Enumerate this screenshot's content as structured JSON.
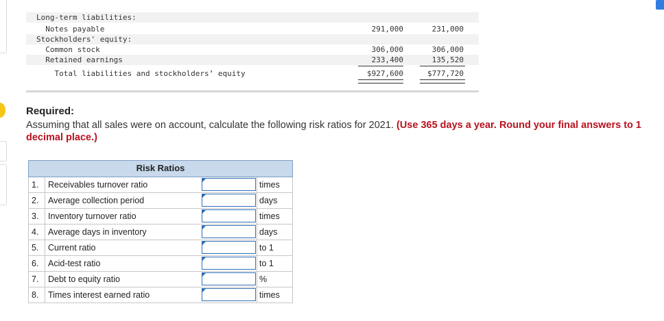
{
  "balance_sheet": {
    "rows": [
      {
        "label": "Long-term liabilities:",
        "v1": "",
        "v2": "",
        "shade": true
      },
      {
        "label": "  Notes payable",
        "v1": "291,000",
        "v2": "231,000",
        "shade": false
      },
      {
        "label": "Stockholders' equity:",
        "v1": "",
        "v2": "",
        "shade": true
      },
      {
        "label": "  Common stock",
        "v1": "306,000",
        "v2": "306,000",
        "shade": false
      },
      {
        "label": "  Retained earnings",
        "v1": "233,400",
        "v2": "135,520",
        "shade": true
      },
      {
        "label": "    Total liabilities and stockholders’ equity",
        "v1": "$927,600",
        "v2": "$777,720",
        "shade": false
      }
    ]
  },
  "required": {
    "title": "Required:",
    "text": "Assuming that all sales were on account, calculate the following risk ratios for 2021. ",
    "emphasis": "(Use 365 days a year. Round your final answers to 1 decimal place.)"
  },
  "risk_table": {
    "header": "Risk Ratios",
    "rows": [
      {
        "num": "1.",
        "label": "Receivables turnover ratio",
        "value": "",
        "unit": "times"
      },
      {
        "num": "2.",
        "label": "Average collection period",
        "value": "",
        "unit": "days"
      },
      {
        "num": "3.",
        "label": "Inventory turnover ratio",
        "value": "",
        "unit": "times"
      },
      {
        "num": "4.",
        "label": "Average days in inventory",
        "value": "",
        "unit": "days"
      },
      {
        "num": "5.",
        "label": "Current ratio",
        "value": "",
        "unit": "to 1"
      },
      {
        "num": "6.",
        "label": "Acid-test ratio",
        "value": "",
        "unit": "to 1"
      },
      {
        "num": "7.",
        "label": "Debt to equity ratio",
        "value": "",
        "unit": "%"
      },
      {
        "num": "8.",
        "label": "Times interest earned ratio",
        "value": "",
        "unit": "times"
      }
    ]
  },
  "colors": {
    "emphasis": "#b8121e",
    "table_header_bg": "#c8d9ec",
    "input_border": "#2f6fb5"
  }
}
